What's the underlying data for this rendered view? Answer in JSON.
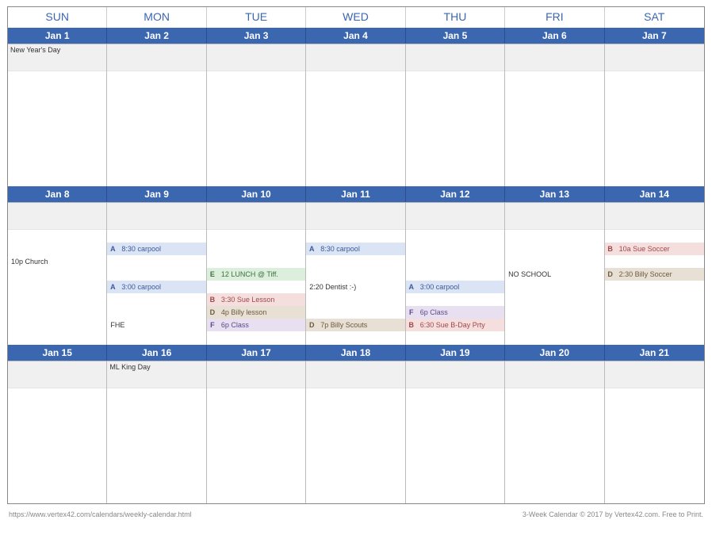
{
  "dow": [
    "SUN",
    "MON",
    "TUE",
    "WED",
    "THU",
    "FRI",
    "SAT"
  ],
  "weeks": [
    {
      "dates": [
        "Jan 1",
        "Jan 2",
        "Jan 3",
        "Jan 4",
        "Jan 5",
        "Jan 6",
        "Jan 7"
      ],
      "strips": [
        "New Year's Day",
        "",
        "",
        "",
        "",
        "",
        ""
      ],
      "events": [
        [],
        [],
        [],
        [],
        [],
        [],
        []
      ]
    },
    {
      "dates": [
        "Jan 8",
        "Jan 9",
        "Jan 10",
        "Jan 11",
        "Jan 12",
        "Jan 13",
        "Jan 14"
      ],
      "strips": [
        "",
        "",
        "",
        "",
        "",
        "",
        ""
      ],
      "events": [
        [
          {
            "type": "sp"
          },
          {
            "type": "sp"
          },
          {
            "type": "plain",
            "text": "10p  Church"
          }
        ],
        [
          {
            "type": "sp"
          },
          {
            "type": "tag",
            "cls": "bg-A",
            "tag": "A",
            "text": "8:30 carpool"
          },
          {
            "type": "sp"
          },
          {
            "type": "sp"
          },
          {
            "type": "tag",
            "cls": "bg-A",
            "tag": "A",
            "text": "3:00 carpool"
          },
          {
            "type": "sp"
          },
          {
            "type": "sp"
          },
          {
            "type": "plain",
            "text": "            FHE",
            "center": true
          }
        ],
        [
          {
            "type": "sp"
          },
          {
            "type": "sp"
          },
          {
            "type": "sp"
          },
          {
            "type": "tag",
            "cls": "bg-E",
            "tag": "E",
            "text": "12 LUNCH @ Tiff."
          },
          {
            "type": "sp"
          },
          {
            "type": "tag",
            "cls": "bg-B",
            "tag": "B",
            "text": "3:30 Sue Lesson"
          },
          {
            "type": "tag",
            "cls": "bg-D",
            "tag": "D",
            "text": "4p Billy lesson"
          },
          {
            "type": "tag",
            "cls": "bg-F",
            "tag": "F",
            "text": "6p Class"
          }
        ],
        [
          {
            "type": "sp"
          },
          {
            "type": "tag",
            "cls": "bg-A",
            "tag": "A",
            "text": "8:30 carpool"
          },
          {
            "type": "sp"
          },
          {
            "type": "sp"
          },
          {
            "type": "plain",
            "text": "2:20  Dentist :-)"
          },
          {
            "type": "sp"
          },
          {
            "type": "sp"
          },
          {
            "type": "tag",
            "cls": "bg-D",
            "tag": "D",
            "text": "7p Billy Scouts"
          }
        ],
        [
          {
            "type": "sp"
          },
          {
            "type": "sp"
          },
          {
            "type": "sp"
          },
          {
            "type": "sp"
          },
          {
            "type": "tag",
            "cls": "bg-A",
            "tag": "A",
            "text": "3:00 carpool"
          },
          {
            "type": "sp"
          },
          {
            "type": "tag",
            "cls": "bg-F",
            "tag": "F",
            "text": "6p Class"
          },
          {
            "type": "tag",
            "cls": "bg-B",
            "tag": "B",
            "text": "6:30 Sue B-Day Prty"
          }
        ],
        [
          {
            "type": "sp"
          },
          {
            "type": "sp"
          },
          {
            "type": "sp"
          },
          {
            "type": "plain",
            "text": "          NO SCHOOL",
            "center": true
          }
        ],
        [
          {
            "type": "sp"
          },
          {
            "type": "tag",
            "cls": "bg-B",
            "tag": "B",
            "text": "10a Sue Soccer"
          },
          {
            "type": "sp"
          },
          {
            "type": "tag",
            "cls": "bg-D",
            "tag": "D",
            "text": "2:30 Billy Soccer"
          }
        ]
      ]
    },
    {
      "dates": [
        "Jan 15",
        "Jan 16",
        "Jan 17",
        "Jan 18",
        "Jan 19",
        "Jan 20",
        "Jan 21"
      ],
      "strips": [
        "",
        "ML King Day",
        "",
        "",
        "",
        "",
        ""
      ],
      "events": [
        [],
        [],
        [],
        [],
        [],
        [],
        []
      ]
    }
  ],
  "footer": {
    "left": "https://www.vertex42.com/calendars/weekly-calendar.html",
    "right": "3-Week Calendar © 2017 by Vertex42.com. Free to Print."
  }
}
